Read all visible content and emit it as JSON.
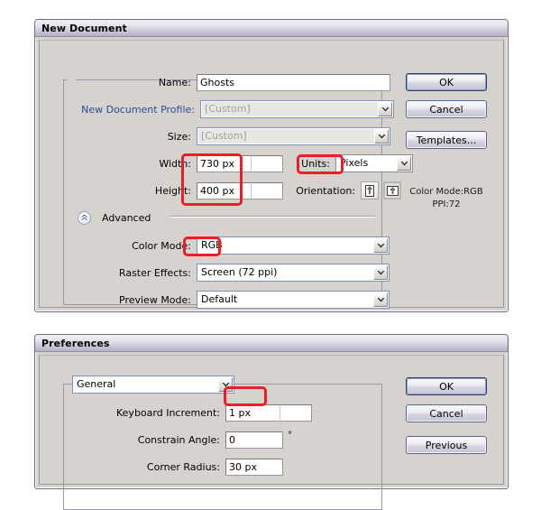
{
  "new_document": {
    "title": "New Document",
    "fields": {
      "name_label": "Name:",
      "name_value": "Ghosts",
      "profile_label": "New Document Profile:",
      "profile_value": "[Custom]",
      "size_label": "Size:",
      "size_value": "[Custom]",
      "width_label": "Width:",
      "width_value": "730 px",
      "height_label": "Height:",
      "height_value": "400 px",
      "units_label": "Units:",
      "units_value": "Pixels",
      "orientation_label": "Orientation:",
      "advanced_label": "Advanced",
      "color_mode_label": "Color Mode:",
      "color_mode_value": "RGB",
      "raster_effects_label": "Raster Effects:",
      "raster_effects_value": "Screen (72 ppi)",
      "preview_mode_label": "Preview Mode:",
      "preview_mode_value": "Default"
    },
    "buttons": {
      "ok": "OK",
      "cancel": "Cancel",
      "templates": "Templates..."
    },
    "info": {
      "color_mode": "Color Mode:RGB",
      "ppi": "PPI:72"
    }
  },
  "preferences": {
    "title": "Preferences",
    "category_value": "General",
    "fields": {
      "keyboard_increment_label": "Keyboard Increment:",
      "keyboard_increment_value": "1 px",
      "constrain_angle_label": "Constrain Angle:",
      "constrain_angle_value": "0",
      "constrain_angle_unit": "°",
      "corner_radius_label": "Corner Radius:",
      "corner_radius_value": "30 px"
    },
    "buttons": {
      "ok": "OK",
      "cancel": "Cancel",
      "previous": "Previous"
    }
  },
  "colors": {
    "annotation": "#ee1c24",
    "dialog_face": "#d6d3ce",
    "legend_blue": "#2d4a9a"
  }
}
